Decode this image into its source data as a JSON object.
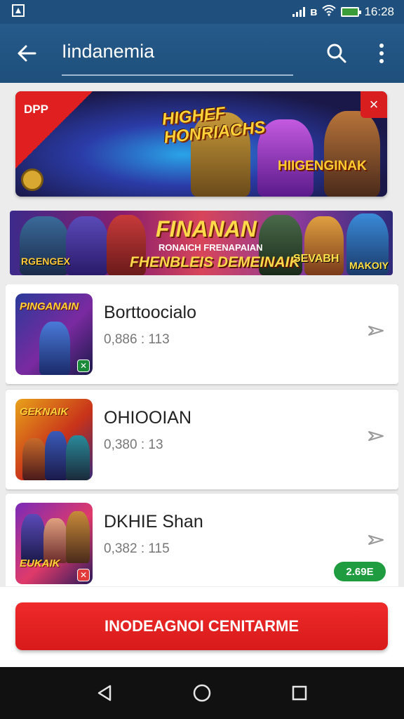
{
  "status_bar": {
    "time": "16:28",
    "icons": [
      "notification-icon",
      "signal-icon",
      "bluetooth-icon",
      "wifi-icon",
      "battery-icon"
    ]
  },
  "app_bar": {
    "search_value": "Iindanemia",
    "back_icon": "arrow-left-icon",
    "search_icon": "search-icon",
    "more_icon": "more-vertical-icon"
  },
  "banner_1": {
    "ribbon": "DPP",
    "close": "×",
    "title": "HIGHEF HONRIACHS",
    "subtitle": "HIIGENGINAK"
  },
  "banner_2": {
    "title": "FINANAN",
    "subtitle_small": "RONAICH FRENAPAIAN",
    "subtitle_large": "FHENBLEIS DEMEINAIK",
    "left_text": "RGENGEX",
    "right_text_1": "SEVABH",
    "right_text_2": "MAKOIY"
  },
  "list": {
    "items": [
      {
        "name": "Borttoocialo",
        "meta": "0,886 : 113",
        "thumb_label": "PINGANAIN",
        "thumb_colors": [
          "#2a3a9a",
          "#7a2aa0",
          "#1a1a4a"
        ]
      },
      {
        "name": "OHIOOIAN",
        "meta": "0,380 : 13",
        "thumb_label": "GEKNAIK",
        "thumb_colors": [
          "#e8a21a",
          "#c8321a",
          "#3a2a7a"
        ]
      },
      {
        "name": "DKHIE Shan",
        "meta": "0,382 : 115",
        "thumb_label": "EUKAIK",
        "thumb_colors": [
          "#7a2ab8",
          "#e03a6a",
          "#2a1a5a"
        ]
      }
    ],
    "price_badge": "2.69E"
  },
  "primary_button": {
    "label": "INODEAGNOI CENITARME"
  },
  "nav_bar": {
    "icons": [
      "back-triangle-icon",
      "home-circle-icon",
      "recents-square-icon"
    ]
  },
  "colors": {
    "app_bar": "#1f4f7b",
    "accent_red": "#d81a1a",
    "badge_green": "#1f9c3f"
  }
}
